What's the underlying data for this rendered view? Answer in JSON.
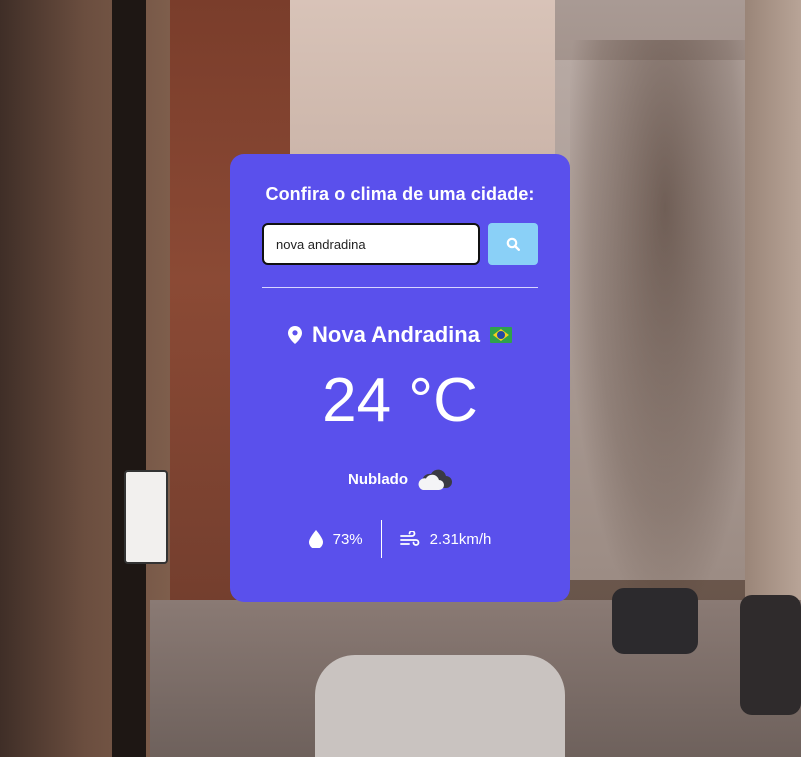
{
  "card": {
    "heading": "Confira o clima de uma cidade:",
    "search": {
      "value": "nova andradina",
      "placeholder": ""
    },
    "search_button_icon": "search-icon"
  },
  "weather": {
    "city": "Nova Andradina",
    "country_flag": "brazil-flag",
    "temperature": "24 °C",
    "condition": "Nublado",
    "condition_icon": "cloud-icon",
    "humidity": "73%",
    "wind": "2.31km/h"
  },
  "colors": {
    "card_bg": "#5a50ec",
    "search_button_bg": "#8ad0f7",
    "text": "#ffffff"
  }
}
